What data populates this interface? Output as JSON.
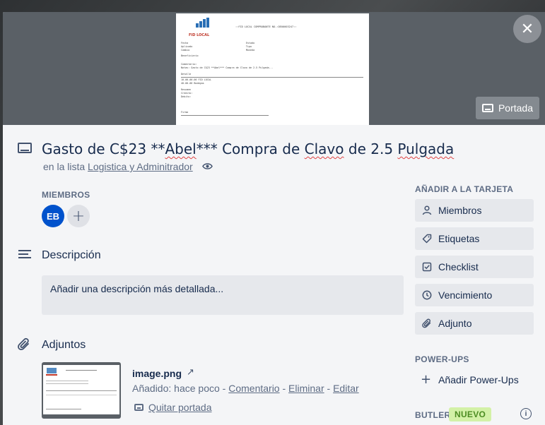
{
  "close_icon": "✕",
  "cover": {
    "button_label": "Portada",
    "document": {
      "logo_text": "FID LOCAL",
      "header": "::FID LOCAL COMPROBANTE NO.:DE00003247::",
      "comment_heading": "Comentario:",
      "comment_text": "Notas: Gasto de C$23 **Abel*** Compra de Clavo de 2.5 Pulgada..."
    }
  },
  "card": {
    "title_part1": "Gasto de C$23 **",
    "title_abel": "Abel",
    "title_part2": "*** Compra de ",
    "title_clavo": "Clavo",
    "title_part3": " de 2.5 ",
    "title_pulgada": "Pulgada",
    "list_prefix": "en la lista",
    "list_name": "Logistica y Adminitrador"
  },
  "members": {
    "label": "MIEMBROS",
    "avatar_initials": "EB",
    "add_symbol": "+"
  },
  "description": {
    "heading": "Descripción",
    "placeholder": "Añadir una descripción más detallada..."
  },
  "attachments": {
    "heading": "Adjuntos",
    "file_name": "image.png",
    "ext_symbol": "↗",
    "added_text": "Añadido: hace poco - ",
    "comment_link": "Comentario",
    "sep1": " - ",
    "delete_link": "Eliminar",
    "sep2": " - ",
    "edit_link": "Editar",
    "remove_cover": "Quitar portada"
  },
  "sidebar": {
    "add_heading": "AÑADIR A LA TARJETA",
    "buttons": {
      "members": "Miembros",
      "labels": "Etiquetas",
      "checklist": "Checklist",
      "due": "Vencimiento",
      "attachment": "Adjunto"
    },
    "powerups_heading": "POWER-UPS",
    "add_powerups": "Añadir Power-Ups",
    "butler_heading": "BUTLER",
    "new_badge": "NUEVO",
    "info_symbol": "i"
  }
}
